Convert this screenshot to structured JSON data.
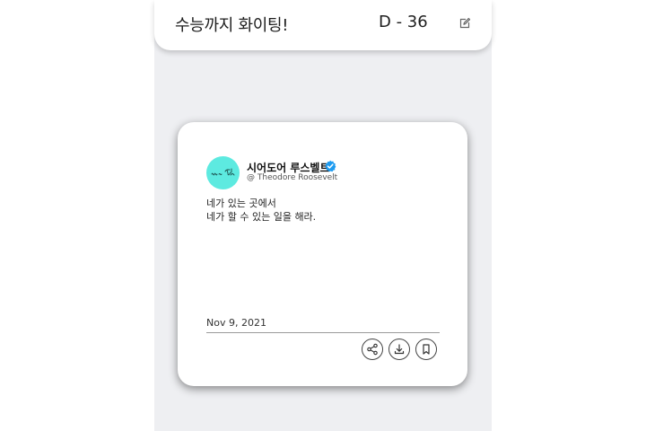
{
  "header": {
    "title": "수능까지 화이팅!",
    "dday": "D - 36",
    "edit_icon": "pencil-edit-icon"
  },
  "card": {
    "avatar_icon": "signature-logo-avatar",
    "display_name": "시어도어 루스벨트",
    "verified_icon": "verified-badge-icon",
    "handle": "@ Theodore Roosevelt",
    "quote_lines": [
      "네가 있는 곳에서",
      "네가 할 수 있는 일을 해라."
    ],
    "date": "Nov 9, 2021",
    "actions": [
      {
        "icon": "share-icon"
      },
      {
        "icon": "download-icon"
      },
      {
        "icon": "bookmark-icon"
      }
    ]
  },
  "colors": {
    "background": "#eeeff2",
    "avatar": "#5deae0",
    "verified": "#1d9bf0"
  }
}
